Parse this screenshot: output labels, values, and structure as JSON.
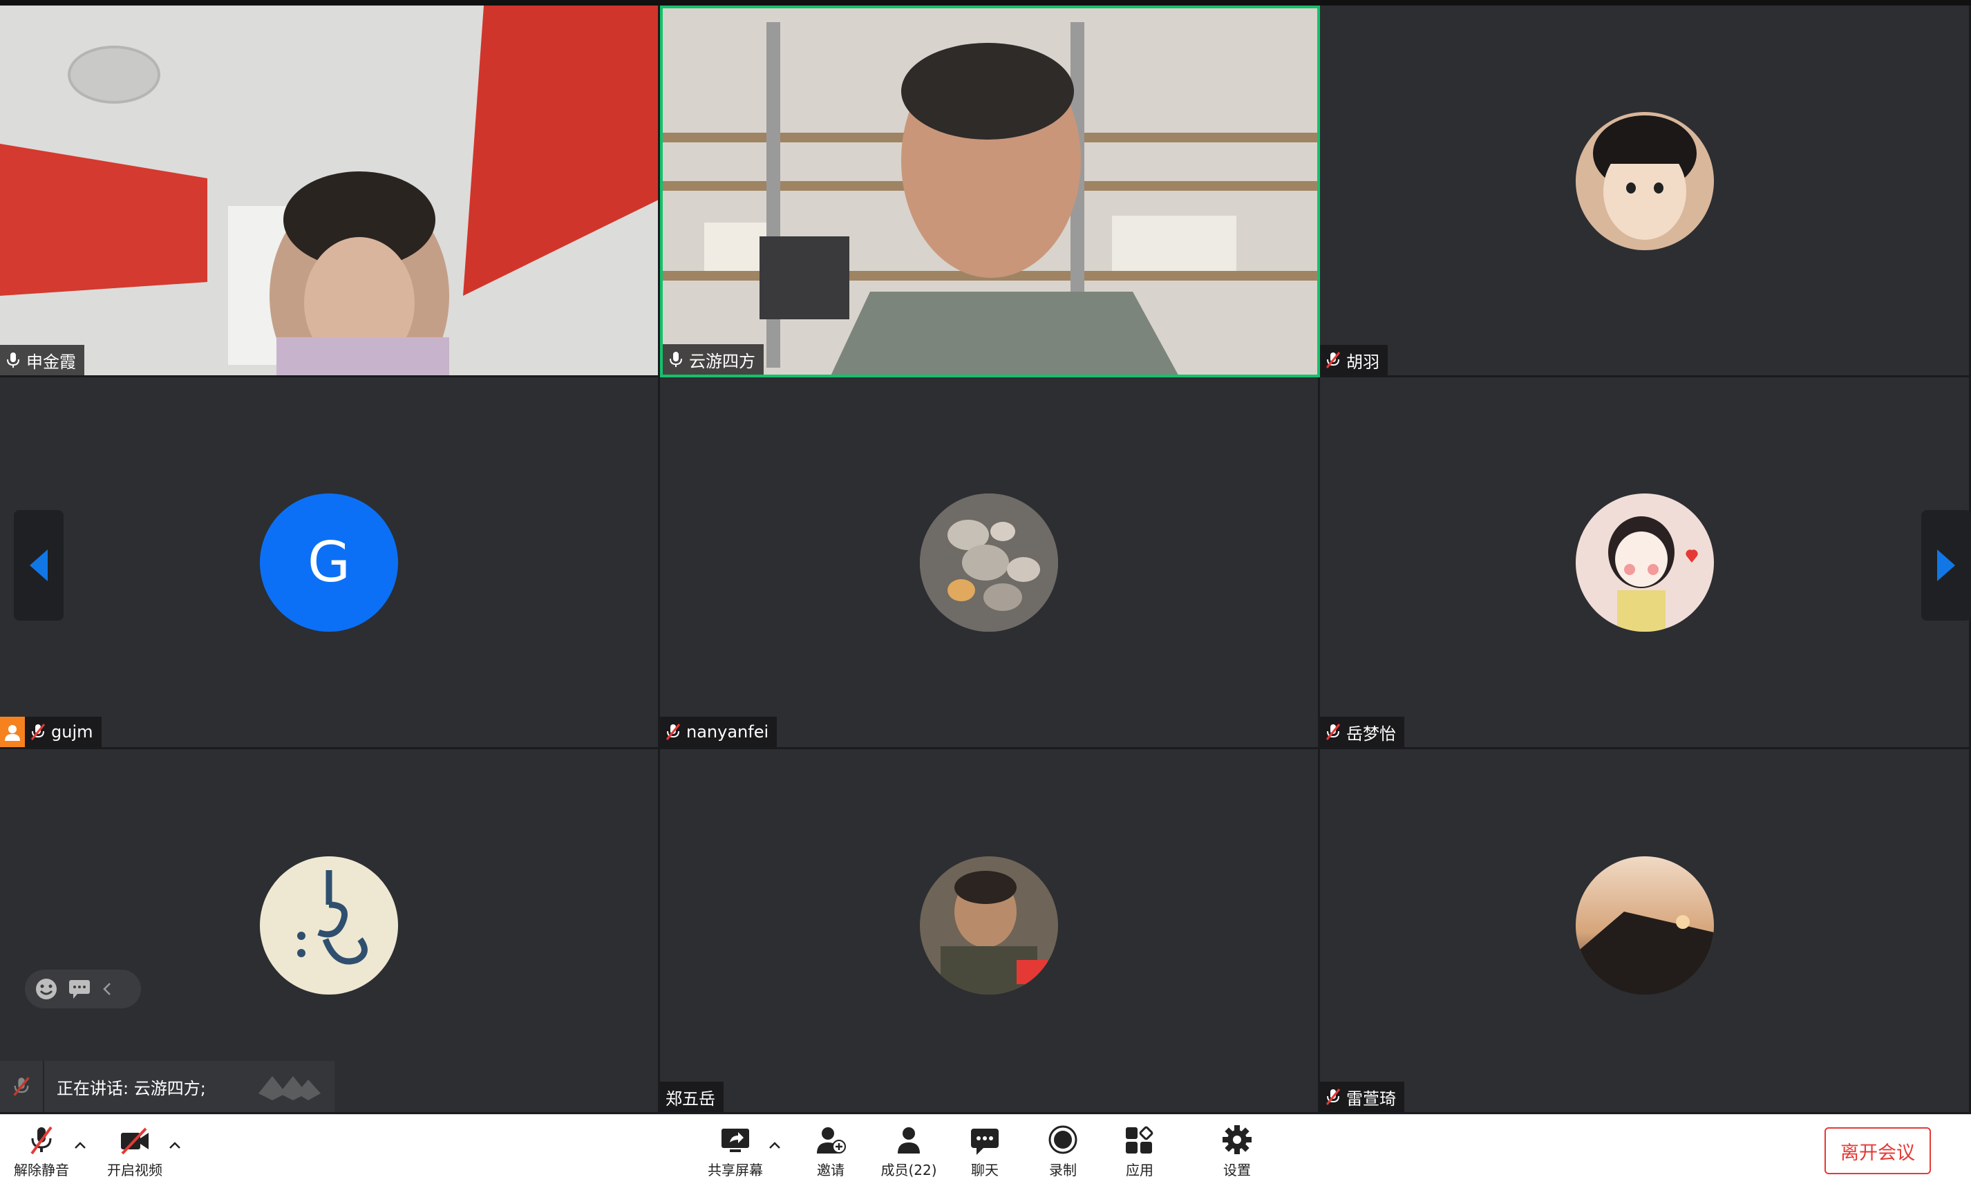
{
  "participants": [
    {
      "name": "申金霞",
      "muted": false,
      "video": true
    },
    {
      "name": "云游四方",
      "muted": false,
      "video": true,
      "speaking": true
    },
    {
      "name": "胡羽",
      "muted": true,
      "video": false
    },
    {
      "name": "gujm",
      "muted": true,
      "video": false,
      "host": true,
      "avatar_letter": "G"
    },
    {
      "name": "nanyanfei",
      "muted": true,
      "video": false
    },
    {
      "name": "岳梦怡",
      "muted": true,
      "video": false
    },
    {
      "name": "",
      "muted": true,
      "video": false
    },
    {
      "name": "郑五岳",
      "muted": false,
      "video": false
    },
    {
      "name": "雷萱琦",
      "muted": true,
      "video": false
    }
  ],
  "speaking_banner": {
    "text": "正在讲话: 云游四方;"
  },
  "toolbar": {
    "unmute_label": "解除静音",
    "video_label": "开启视频",
    "share_label": "共享屏幕",
    "invite_label": "邀请",
    "members_label": "成员(22)",
    "chat_label": "聊天",
    "record_label": "录制",
    "apps_label": "应用",
    "settings_label": "设置",
    "leave_label": "离开会议"
  },
  "colors": {
    "speaking_border": "#13c26b",
    "leave_red": "#e53935",
    "avatar_blue": "#0b70f5",
    "host_orange": "#f5821f"
  }
}
